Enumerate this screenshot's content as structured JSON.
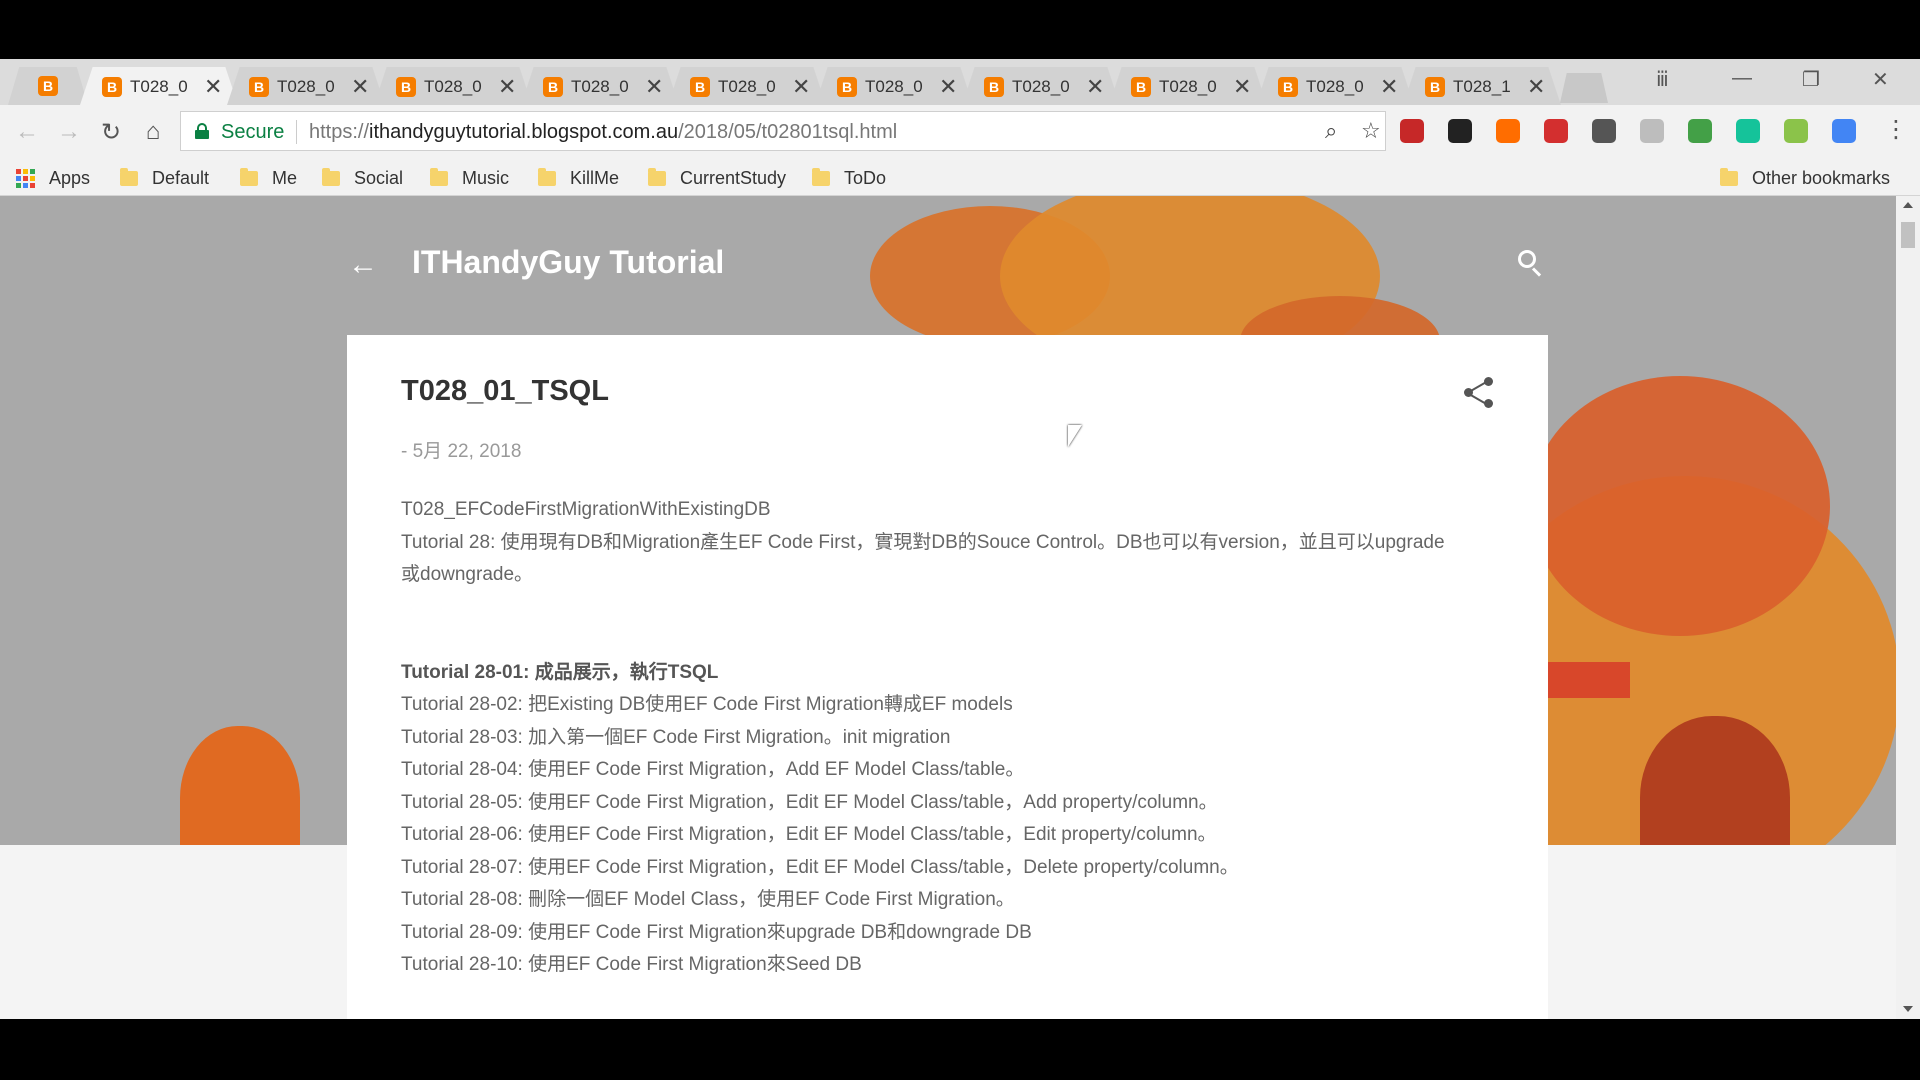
{
  "browser": {
    "tabs": [
      {
        "title": "T028_0"
      },
      {
        "title": "T028_0"
      },
      {
        "title": "T028_0"
      },
      {
        "title": "T028_0"
      },
      {
        "title": "T028_0"
      },
      {
        "title": "T028_0"
      },
      {
        "title": "T028_0"
      },
      {
        "title": "T028_0"
      },
      {
        "title": "T028_0"
      },
      {
        "title": "T028_1"
      }
    ],
    "active_tab": 0,
    "close_glyph": "✕",
    "secure_label": "Secure",
    "url_prefix": "https://",
    "url_host": "ithandyguytutorial.blogspot.com.au",
    "url_path": "/2018/05/t02801tsql.html",
    "extension_colors": [
      "#c62828",
      "#222222",
      "#ff6d00",
      "#d32f2f",
      "#555555",
      "#bdbdbd",
      "#43a047",
      "#15c39a",
      "#8bc34a",
      "#4285f4"
    ],
    "bookmarks": {
      "apps_label": "Apps",
      "folders": [
        "Default",
        "Me",
        "Social",
        "Music",
        "KillMe",
        "CurrentStudy",
        "ToDo"
      ],
      "other_label": "Other bookmarks"
    }
  },
  "blog": {
    "title": "ITHandyGuy Tutorial",
    "post": {
      "title": "T028_01_TSQL",
      "date": "- 5月 22, 2018",
      "intro": [
        "T028_EFCodeFirstMigrationWithExistingDB",
        "Tutorial 28: 使用現有DB和Migration產生EF Code First，實現對DB的Souce Control。DB也可以有version，並且可以upgrade或downgrade。"
      ],
      "items": [
        "Tutorial 28-01: 成品展示，執行TSQL",
        "Tutorial 28-02: 把Existing DB使用EF Code First Migration轉成EF models",
        "Tutorial 28-03: 加入第一個EF Code First Migration。init migration",
        "Tutorial 28-04: 使用EF Code First Migration，Add EF Model Class/table。",
        "Tutorial 28-05: 使用EF Code First Migration，Edit EF Model Class/table，Add property/column。",
        "Tutorial 28-06: 使用EF Code First Migration，Edit EF Model Class/table，Edit property/column。",
        "Tutorial 28-07: 使用EF Code First Migration，Edit EF Model Class/table，Delete property/column。",
        "Tutorial 28-08: 刪除一個EF Model Class，使用EF Code First Migration。",
        "Tutorial 28-09: 使用EF Code First Migration來upgrade DB和downgrade DB",
        "Tutorial 28-10: 使用EF Code First Migration來Seed DB"
      ]
    }
  },
  "colors": {
    "accent_secure": "#0b8043",
    "blogger_orange": "#f57d00",
    "hero_gray": "#a9a9a9"
  }
}
